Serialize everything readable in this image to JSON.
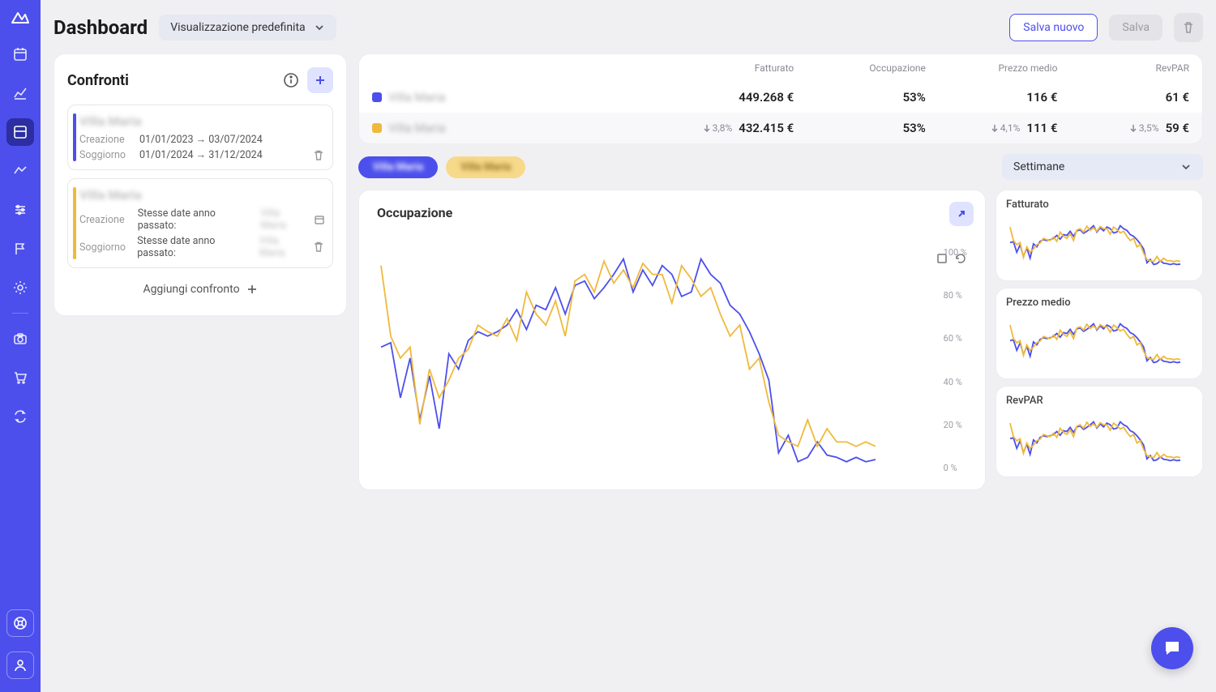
{
  "header": {
    "title": "Dashboard",
    "view_label": "Visualizzazione predefinita",
    "save_new": "Salva nuovo",
    "save": "Salva"
  },
  "confronti": {
    "title": "Confronti",
    "add_label": "Aggiungi confronto",
    "items": [
      {
        "color": "blue",
        "name": "Villa Maria",
        "creazione_label": "Creazione",
        "creazione_value": "01/01/2023 → 03/07/2024",
        "soggiorno_label": "Soggiorno",
        "soggiorno_value": "01/01/2024 → 31/12/2024"
      },
      {
        "color": "yellow",
        "name": "Villa Maria",
        "creazione_label": "Creazione",
        "creazione_prefix": "Stesse date anno passato:",
        "creazione_blur": "Villa Maria",
        "soggiorno_label": "Soggiorno",
        "soggiorno_prefix": "Stesse date anno passato:",
        "soggiorno_blur": "Villa Maria"
      }
    ]
  },
  "stats": {
    "headers": [
      "",
      "Fatturato",
      "Occupazione",
      "Prezzo medio",
      "RevPAR"
    ],
    "rows": [
      {
        "swatch": "blue",
        "name": "Villa Maria",
        "fatturato": "449.268 €",
        "occupazione": "53%",
        "prezzo": "116 €",
        "revpar": "61 €"
      },
      {
        "swatch": "yellow",
        "name": "Villa Maria",
        "fatturato_diff": "3,8%",
        "fatturato": "432.415 €",
        "occupazione": "53%",
        "prezzo_diff": "4,1%",
        "prezzo": "111 €",
        "revpar_diff": "3,5%",
        "revpar": "59 €"
      }
    ]
  },
  "pills": {
    "p1": "Villa Maria",
    "p2": "Villa Maria"
  },
  "period": {
    "selected": "Settimane"
  },
  "main_chart": {
    "title": "Occupazione",
    "y_ticks": [
      "100 %",
      "80 %",
      "60 %",
      "40 %",
      "20 %",
      "0 %"
    ]
  },
  "mini_charts": {
    "c1": "Fatturato",
    "c2": "Prezzo medio",
    "c3": "RevPAR"
  },
  "chart_data": {
    "type": "line",
    "title": "Occupazione",
    "ylabel": "%",
    "ylim": [
      0,
      100
    ],
    "x": [
      0,
      1,
      2,
      3,
      4,
      5,
      6,
      7,
      8,
      9,
      10,
      11,
      12,
      13,
      14,
      15,
      16,
      17,
      18,
      19,
      20,
      21,
      22,
      23,
      24,
      25,
      26,
      27,
      28,
      29,
      30,
      31,
      32,
      33,
      34,
      35,
      36,
      37,
      38,
      39,
      40,
      41,
      42,
      43,
      44,
      45,
      46,
      47,
      48,
      49,
      50,
      51
    ],
    "series": [
      {
        "name": "Villa Maria (blue)",
        "color": "#4c4fec",
        "values": [
          55,
          57,
          32,
          50,
          22,
          42,
          18,
          52,
          45,
          58,
          62,
          60,
          62,
          65,
          72,
          63,
          74,
          72,
          82,
          70,
          83,
          85,
          77,
          82,
          88,
          95,
          80,
          90,
          83,
          92,
          88,
          78,
          80,
          95,
          88,
          84,
          74,
          70,
          62,
          52,
          40,
          7,
          15,
          3,
          5,
          12,
          6,
          5,
          3,
          5,
          3,
          4
        ]
      },
      {
        "name": "Villa Maria (yellow)",
        "color": "#f0b93b",
        "values": [
          92,
          60,
          50,
          55,
          20,
          45,
          32,
          40,
          50,
          54,
          65,
          62,
          60,
          68,
          58,
          80,
          70,
          65,
          76,
          60,
          85,
          88,
          80,
          94,
          84,
          90,
          82,
          93,
          88,
          88,
          75,
          92,
          86,
          78,
          82,
          70,
          60,
          65,
          45,
          50,
          30,
          15,
          12,
          10,
          22,
          10,
          18,
          12,
          12,
          10,
          12,
          10
        ]
      }
    ]
  }
}
